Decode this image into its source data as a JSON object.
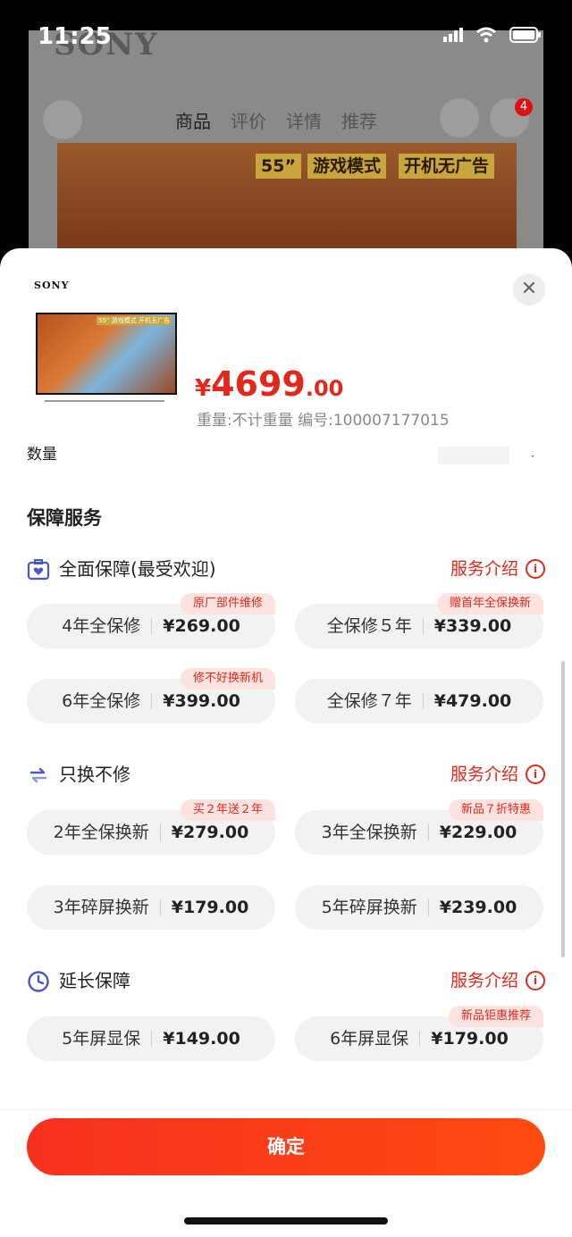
{
  "status_bar": {
    "time": "11:25"
  },
  "background": {
    "brand": "SONY",
    "tabs": [
      "商品",
      "评价",
      "详情",
      "推荐"
    ],
    "badge_count": "4",
    "banner_tags": [
      "55”",
      "游戏模式",
      "开机无广告"
    ]
  },
  "sheet": {
    "brand_logo": "SONY",
    "thumb_tags": "55” 游戏模式 开机无广告",
    "price": {
      "symbol": "¥",
      "integer": "4699",
      "decimal": ".00"
    },
    "meta": "重量:不计重量  编号:100007177015",
    "cut_row_label": "数量",
    "section_title": "保障服务",
    "groups": [
      {
        "name": "全面保障(最受欢迎)",
        "intro": "服务介绍",
        "options": [
          {
            "name": "4年全保修",
            "price": "¥269.00",
            "tag": "原厂部件维修"
          },
          {
            "name": "全保修５年",
            "price": "¥339.00",
            "tag": "赠首年全保换新"
          },
          {
            "name": "6年全保修",
            "price": "¥399.00",
            "tag": "修不好换新机"
          },
          {
            "name": "全保修７年",
            "price": "¥479.00",
            "tag": ""
          }
        ]
      },
      {
        "name": "只换不修",
        "intro": "服务介绍",
        "options": [
          {
            "name": "2年全保换新",
            "price": "¥279.00",
            "tag": "买２年送２年"
          },
          {
            "name": "3年全保换新",
            "price": "¥229.00",
            "tag": "新品７折特惠"
          },
          {
            "name": "3年碎屏换新",
            "price": "¥179.00",
            "tag": ""
          },
          {
            "name": "5年碎屏换新",
            "price": "¥239.00",
            "tag": ""
          }
        ]
      },
      {
        "name": "延长保障",
        "intro": "服务介绍",
        "options": [
          {
            "name": "5年屏显保",
            "price": "¥149.00",
            "tag": ""
          },
          {
            "name": "6年屏显保",
            "price": "¥179.00",
            "tag": "新品钜惠推荐"
          }
        ]
      }
    ],
    "confirm_label": "确定",
    "colors": {
      "accent": "#e4271a",
      "button": "#f6301f",
      "chip_bg": "#f2f2f2",
      "tag_bg": "#fde3e0"
    }
  }
}
